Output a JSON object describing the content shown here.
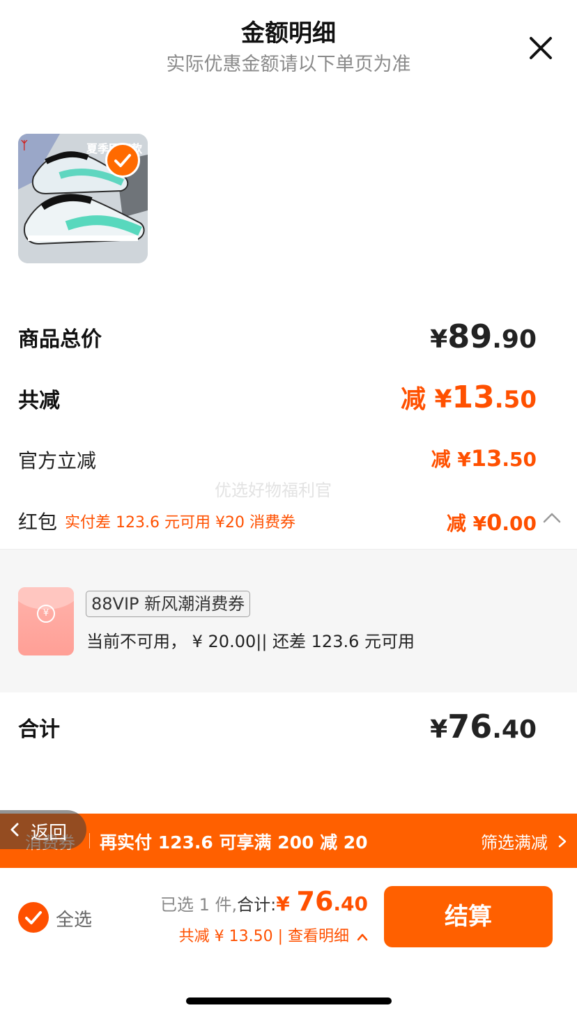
{
  "header": {
    "title": "金额明细",
    "subtitle": "实际优惠金额请以下单页为准"
  },
  "product": {
    "badge_text": "夏季网面款",
    "checked": true
  },
  "summary": {
    "goods_total_label": "商品总价",
    "goods_total": {
      "currency": "¥",
      "int": "89",
      "dec": ".90"
    },
    "total_discount_label": "共减",
    "total_discount": {
      "prefix": "减 ¥",
      "int": "13",
      "dec": ".50"
    },
    "official_discount_label": "官方立减",
    "official_discount": {
      "prefix": "减 ¥",
      "int": "13",
      "dec": ".50"
    },
    "watermark": "优选好物福利官",
    "red_packet_label": "红包",
    "red_packet_note": "实付差 123.6 元可用 ¥20 消费券",
    "red_packet_discount": {
      "prefix": "减 ¥",
      "int": "0",
      "dec": ".00"
    },
    "total_label": "合计",
    "total": {
      "currency": "¥",
      "int": "76",
      "dec": ".40"
    }
  },
  "coupon": {
    "icon": "red-envelope-icon",
    "icon_symbol": "¥",
    "name": "88VIP 新风潮消费券",
    "status": "当前不可用， ¥ 20.00|| 还差 123.6 元可用"
  },
  "promo_bar": {
    "tag": "消费券",
    "message": "再实付 123.6 可享满 200 减 20",
    "filter_label": "筛选满减"
  },
  "back_button": {
    "label": "返回"
  },
  "bottom_bar": {
    "select_all_label": "全选",
    "selected_count": "已选 1 件,",
    "total_prefix": "合计:",
    "total": {
      "currency": "¥ ",
      "int": "76",
      "dec": ".40"
    },
    "savings_text": "共减 ¥ 13.50 | 查看明细",
    "checkout_label": "结算"
  },
  "colors": {
    "accent": "#ff5000",
    "promo_bar": "#ff6000",
    "panel_bg": "#f6f6f6"
  }
}
